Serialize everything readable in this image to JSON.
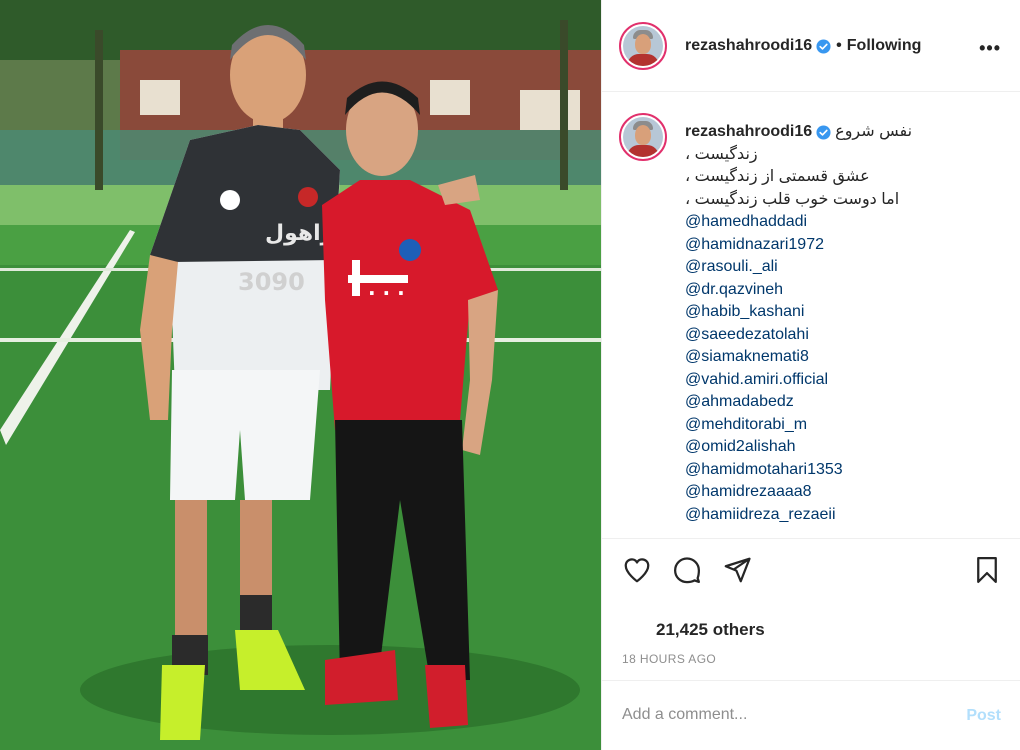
{
  "post": {
    "username": "rezashahroodi16",
    "separator": "•",
    "follow_status": "Following",
    "more_label": "•••"
  },
  "caption": {
    "username": "rezashahroodi16",
    "lines": [
      "نفس شروع",
      "زندگیست ،",
      "عشق قسمتی از زندگیست ،",
      "اما دوست خوب قلب زندگیست ،"
    ],
    "mentions": [
      "@hamedhaddadi",
      "@hamidnazari1972",
      "@rasouli._ali",
      "@dr.qazvineh",
      "@habib_kashani",
      "@saeedezatolahi",
      "@siamaknemati8",
      "@vahid.amiri.official",
      "@ahmadabedz",
      "@mehditorabi_m",
      "@omid2alishah",
      "@hamidmotahari1353",
      "@hamidrezaaaa8",
      "@hamiidreza_rezaeii"
    ]
  },
  "engagement": {
    "likes_text": "21,425 others",
    "time_ago": "18 HOURS AGO"
  },
  "comment": {
    "placeholder": "Add a comment...",
    "post_label": "Post"
  },
  "icons": {
    "verified": "verified-badge-icon",
    "like": "heart-icon",
    "comment": "comment-bubble-icon",
    "share": "paper-plane-icon",
    "save": "bookmark-icon"
  },
  "colors": {
    "verified_blue": "#3897f0",
    "mention_blue": "#00376b",
    "muted_gray": "#8e8e8e",
    "post_button_disabled": "#b2dffc",
    "avatar_ring": "#e1306c"
  }
}
